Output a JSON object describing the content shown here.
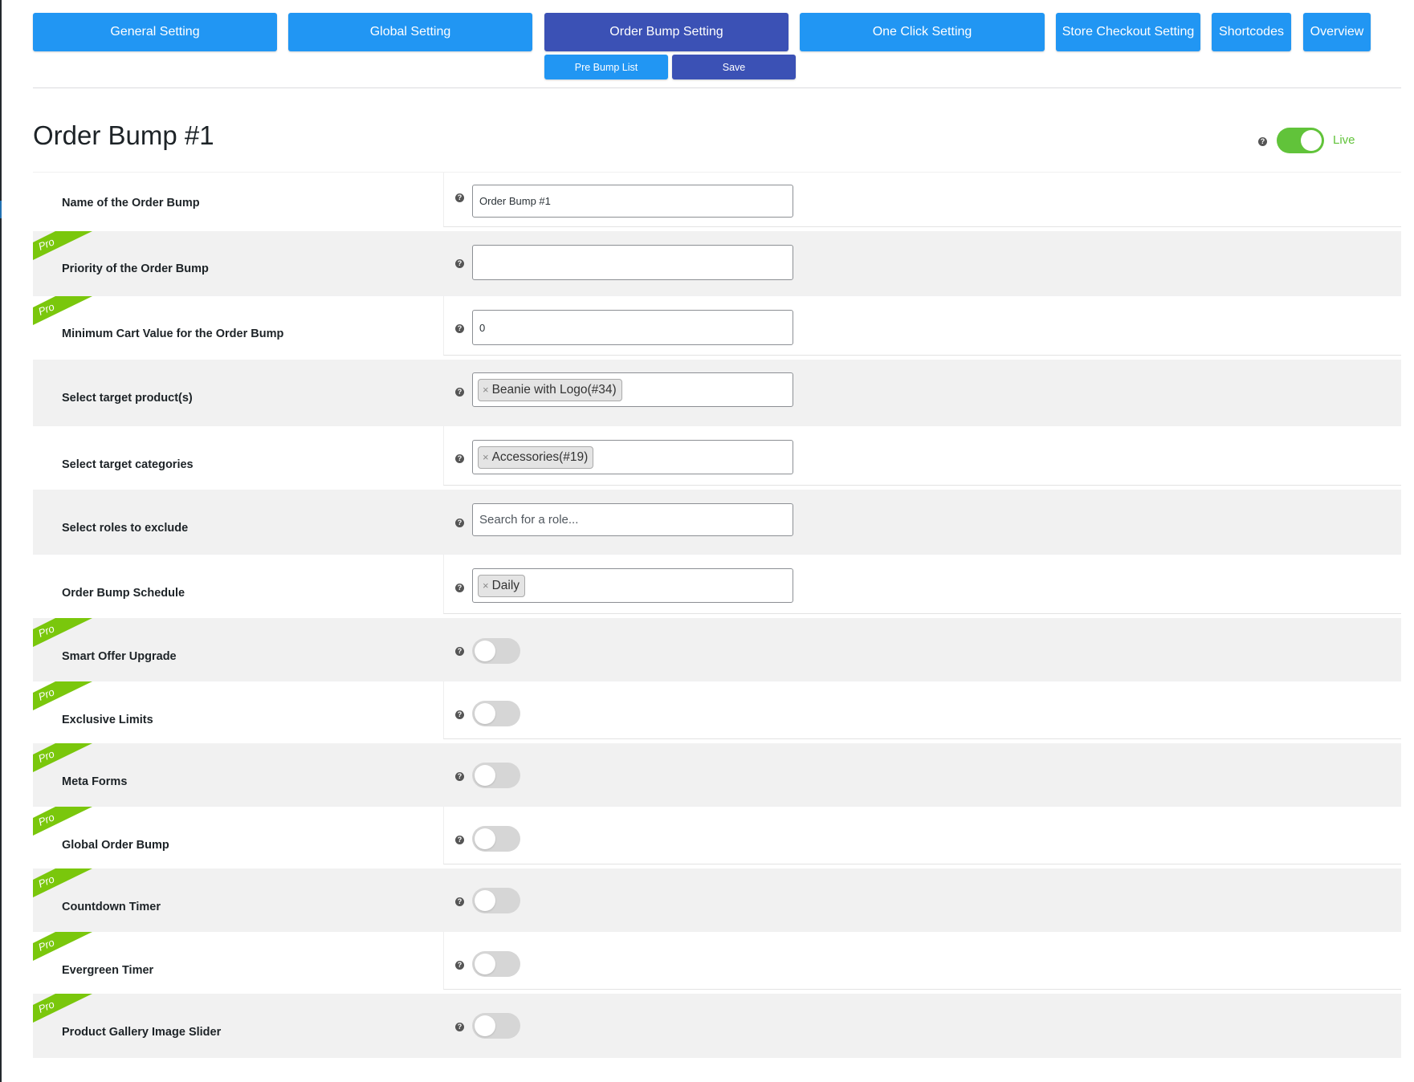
{
  "tabs": [
    {
      "label": "General Setting",
      "active": false
    },
    {
      "label": "Global Setting",
      "active": false
    },
    {
      "label": "Order Bump Setting",
      "active": true
    },
    {
      "label": "One Click Setting",
      "active": false
    },
    {
      "label": "Store Checkout Setting",
      "active": false
    },
    {
      "label": "Shortcodes",
      "active": false
    },
    {
      "label": "Overview",
      "active": false
    }
  ],
  "subactions": {
    "pre_bump_list": "Pre Bump List",
    "save": "Save"
  },
  "page": {
    "title": "Order Bump #1",
    "status_label": "Live",
    "status_on": true
  },
  "pro_badge": "Pro",
  "fields": {
    "name": {
      "label": "Name of the Order Bump",
      "value": "Order Bump #1"
    },
    "priority": {
      "label": "Priority of the Order Bump",
      "value": ""
    },
    "min_cart": {
      "label": "Minimum Cart Value for the Order Bump",
      "value": "0"
    },
    "target_products": {
      "label": "Select target product(s)",
      "chip": "Beanie with Logo(#34)"
    },
    "target_categories": {
      "label": "Select target categories",
      "chip": "Accessories(#19)"
    },
    "exclude_roles": {
      "label": "Select roles to exclude",
      "placeholder": "Search for a role..."
    },
    "schedule": {
      "label": "Order Bump Schedule",
      "chip": "Daily"
    },
    "smart_offer": {
      "label": "Smart Offer Upgrade",
      "on": false
    },
    "exclusive_limits": {
      "label": "Exclusive Limits",
      "on": false
    },
    "meta_forms": {
      "label": "Meta Forms",
      "on": false
    },
    "global_bump": {
      "label": "Global Order Bump",
      "on": false
    },
    "countdown": {
      "label": "Countdown Timer",
      "on": false
    },
    "evergreen": {
      "label": "Evergreen Timer",
      "on": false
    },
    "gallery_slider": {
      "label": "Product Gallery Image Slider",
      "on": false
    }
  },
  "colors": {
    "tab_blue": "#2196f3",
    "tab_active": "#3b51b5",
    "live_green": "#61c33a",
    "pro_green": "#7ac70c"
  }
}
